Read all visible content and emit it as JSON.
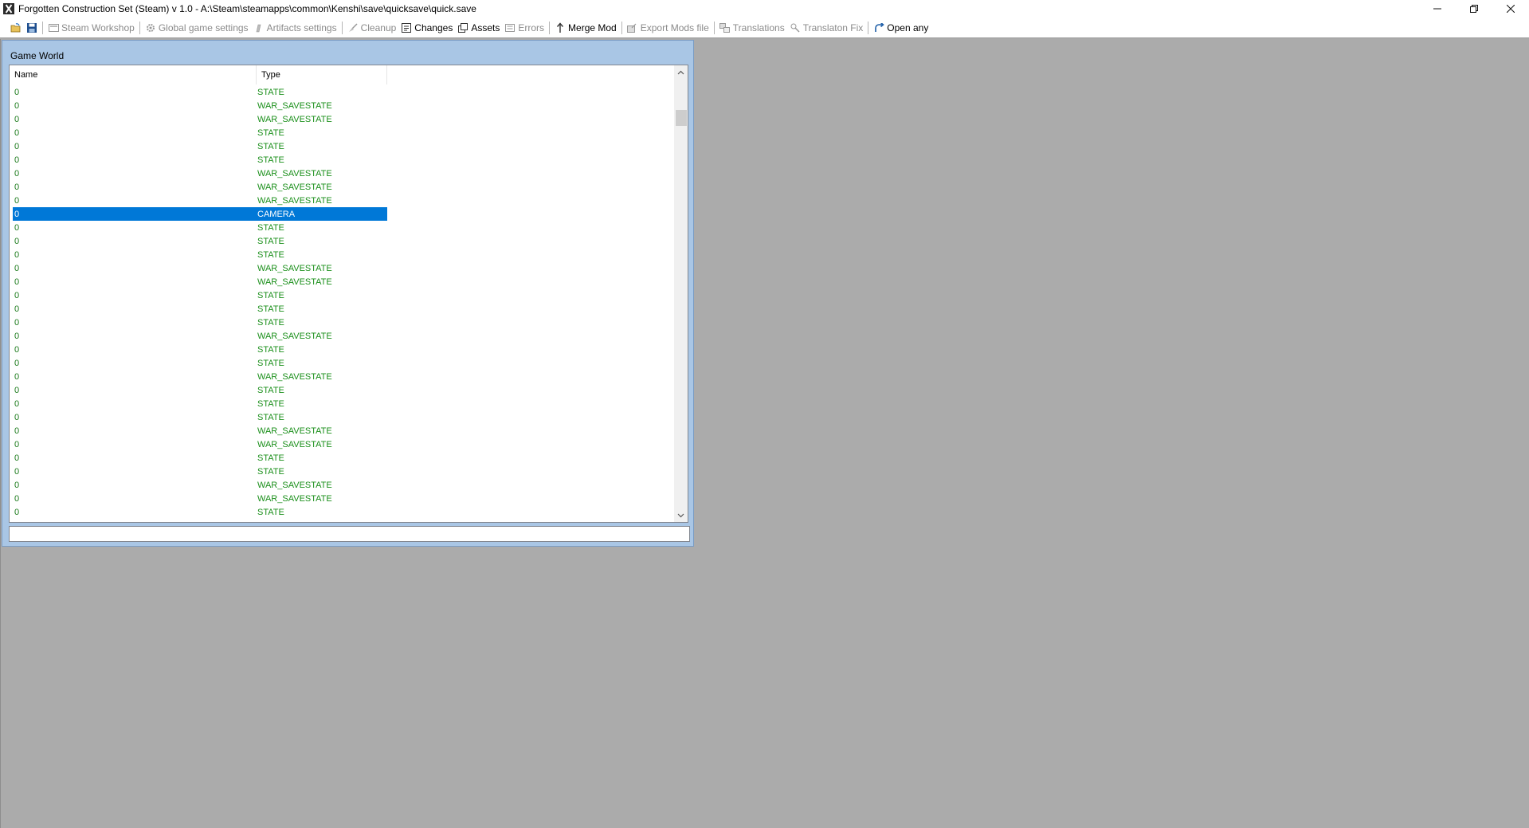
{
  "window": {
    "title": "Forgotten Construction Set (Steam) v 1.0 - A:\\Steam\\steamapps\\common\\Kenshi\\save\\quicksave\\quick.save"
  },
  "toolbar": {
    "items": [
      {
        "label": "Steam Workshop",
        "icon": "workshop-icon",
        "enabled": false
      },
      {
        "label": "Global game settings",
        "icon": "gear-icon",
        "enabled": false
      },
      {
        "label": "Artifacts settings",
        "icon": "artifact-icon",
        "enabled": false
      },
      {
        "label": "Cleanup",
        "icon": "broom-icon",
        "enabled": false
      },
      {
        "label": "Changes",
        "icon": "changes-icon",
        "enabled": true
      },
      {
        "label": "Assets",
        "icon": "assets-icon",
        "enabled": true
      },
      {
        "label": "Errors",
        "icon": "errors-icon",
        "enabled": false
      },
      {
        "label": "Merge Mod",
        "icon": "merge-icon",
        "enabled": true
      },
      {
        "label": "Export Mods file",
        "icon": "export-icon",
        "enabled": false
      },
      {
        "label": "Translations",
        "icon": "translations-icon",
        "enabled": false
      },
      {
        "label": "Translaton Fix",
        "icon": "translation-fix-icon",
        "enabled": false
      },
      {
        "label": "Open any",
        "icon": "open-any-icon",
        "enabled": true
      }
    ]
  },
  "game_world": {
    "title": "Game World",
    "columns": {
      "name": "Name",
      "type": "Type"
    },
    "rows": [
      {
        "name": "0",
        "type": "STATE"
      },
      {
        "name": "0",
        "type": "WAR_SAVESTATE"
      },
      {
        "name": "0",
        "type": "WAR_SAVESTATE"
      },
      {
        "name": "0",
        "type": "STATE"
      },
      {
        "name": "0",
        "type": "STATE"
      },
      {
        "name": "0",
        "type": "STATE"
      },
      {
        "name": "0",
        "type": "WAR_SAVESTATE"
      },
      {
        "name": "0",
        "type": "WAR_SAVESTATE"
      },
      {
        "name": "0",
        "type": "WAR_SAVESTATE"
      },
      {
        "name": "0",
        "type": "CAMERA",
        "selected": true
      },
      {
        "name": "0",
        "type": "STATE"
      },
      {
        "name": "0",
        "type": "STATE"
      },
      {
        "name": "0",
        "type": "STATE"
      },
      {
        "name": "0",
        "type": "WAR_SAVESTATE"
      },
      {
        "name": "0",
        "type": "WAR_SAVESTATE"
      },
      {
        "name": "0",
        "type": "STATE"
      },
      {
        "name": "0",
        "type": "STATE"
      },
      {
        "name": "0",
        "type": "STATE"
      },
      {
        "name": "0",
        "type": "WAR_SAVESTATE"
      },
      {
        "name": "0",
        "type": "STATE"
      },
      {
        "name": "0",
        "type": "STATE"
      },
      {
        "name": "0",
        "type": "WAR_SAVESTATE"
      },
      {
        "name": "0",
        "type": "STATE"
      },
      {
        "name": "0",
        "type": "STATE"
      },
      {
        "name": "0",
        "type": "STATE"
      },
      {
        "name": "0",
        "type": "WAR_SAVESTATE"
      },
      {
        "name": "0",
        "type": "WAR_SAVESTATE"
      },
      {
        "name": "0",
        "type": "STATE"
      },
      {
        "name": "0",
        "type": "STATE"
      },
      {
        "name": "0",
        "type": "WAR_SAVESTATE"
      },
      {
        "name": "0",
        "type": "WAR_SAVESTATE"
      },
      {
        "name": "0",
        "type": "STATE"
      }
    ],
    "status_text": ""
  },
  "colors": {
    "selection": "#0078d7",
    "row_text": "#1a8f1a",
    "mdi_background": "#ababab",
    "child_frame": "#a9c6e5"
  }
}
